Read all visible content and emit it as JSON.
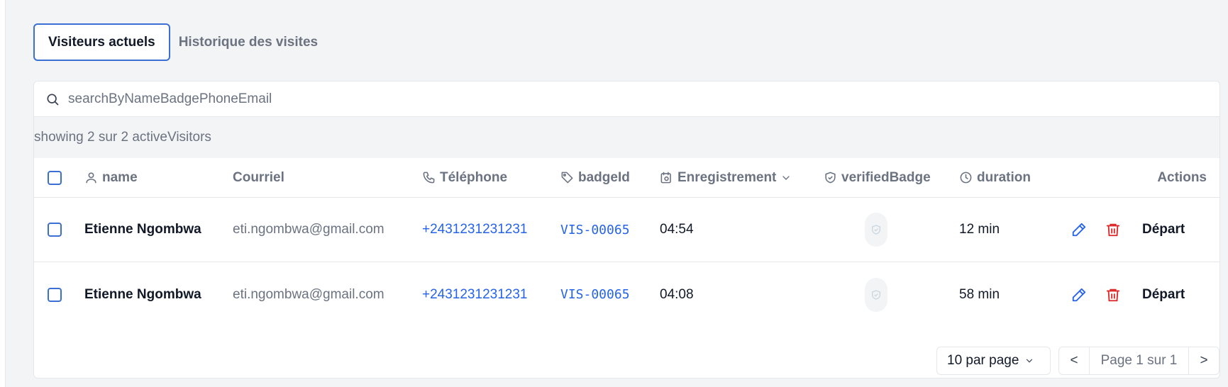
{
  "tabs": [
    {
      "label": "Visiteurs actuels",
      "active": true
    },
    {
      "label": "Historique des visites",
      "active": false
    }
  ],
  "search": {
    "placeholder": "searchByNameBadgePhoneEmail",
    "value": ""
  },
  "summary": "showing 2 sur 2 activeVisitors",
  "table": {
    "columns": {
      "name": "name",
      "email": "Courriel",
      "phone": "Téléphone",
      "badge": "badgeId",
      "registration": "Enregistrement",
      "verified": "verifiedBadge",
      "duration": "duration",
      "actions": "Actions"
    },
    "rows": [
      {
        "name": "Etienne Ngombwa",
        "email": "eti.ngombwa@gmail.com",
        "phone": "+2431231231231",
        "badge": "VIS-00065",
        "registration": "04:54",
        "duration": "12 min",
        "action_label": "Départ"
      },
      {
        "name": "Etienne Ngombwa",
        "email": "eti.ngombwa@gmail.com",
        "phone": "+2431231231231",
        "badge": "VIS-00065",
        "registration": "04:08",
        "duration": "58 min",
        "action_label": "Départ"
      }
    ]
  },
  "pagination": {
    "per_page_label": "10 par page",
    "prev": "<",
    "page_info": "Page 1 sur 1",
    "next": ">"
  },
  "colors": {
    "accent": "#3b6fd4",
    "link": "#2563eb",
    "danger": "#dc2626",
    "muted": "#6b7280"
  }
}
